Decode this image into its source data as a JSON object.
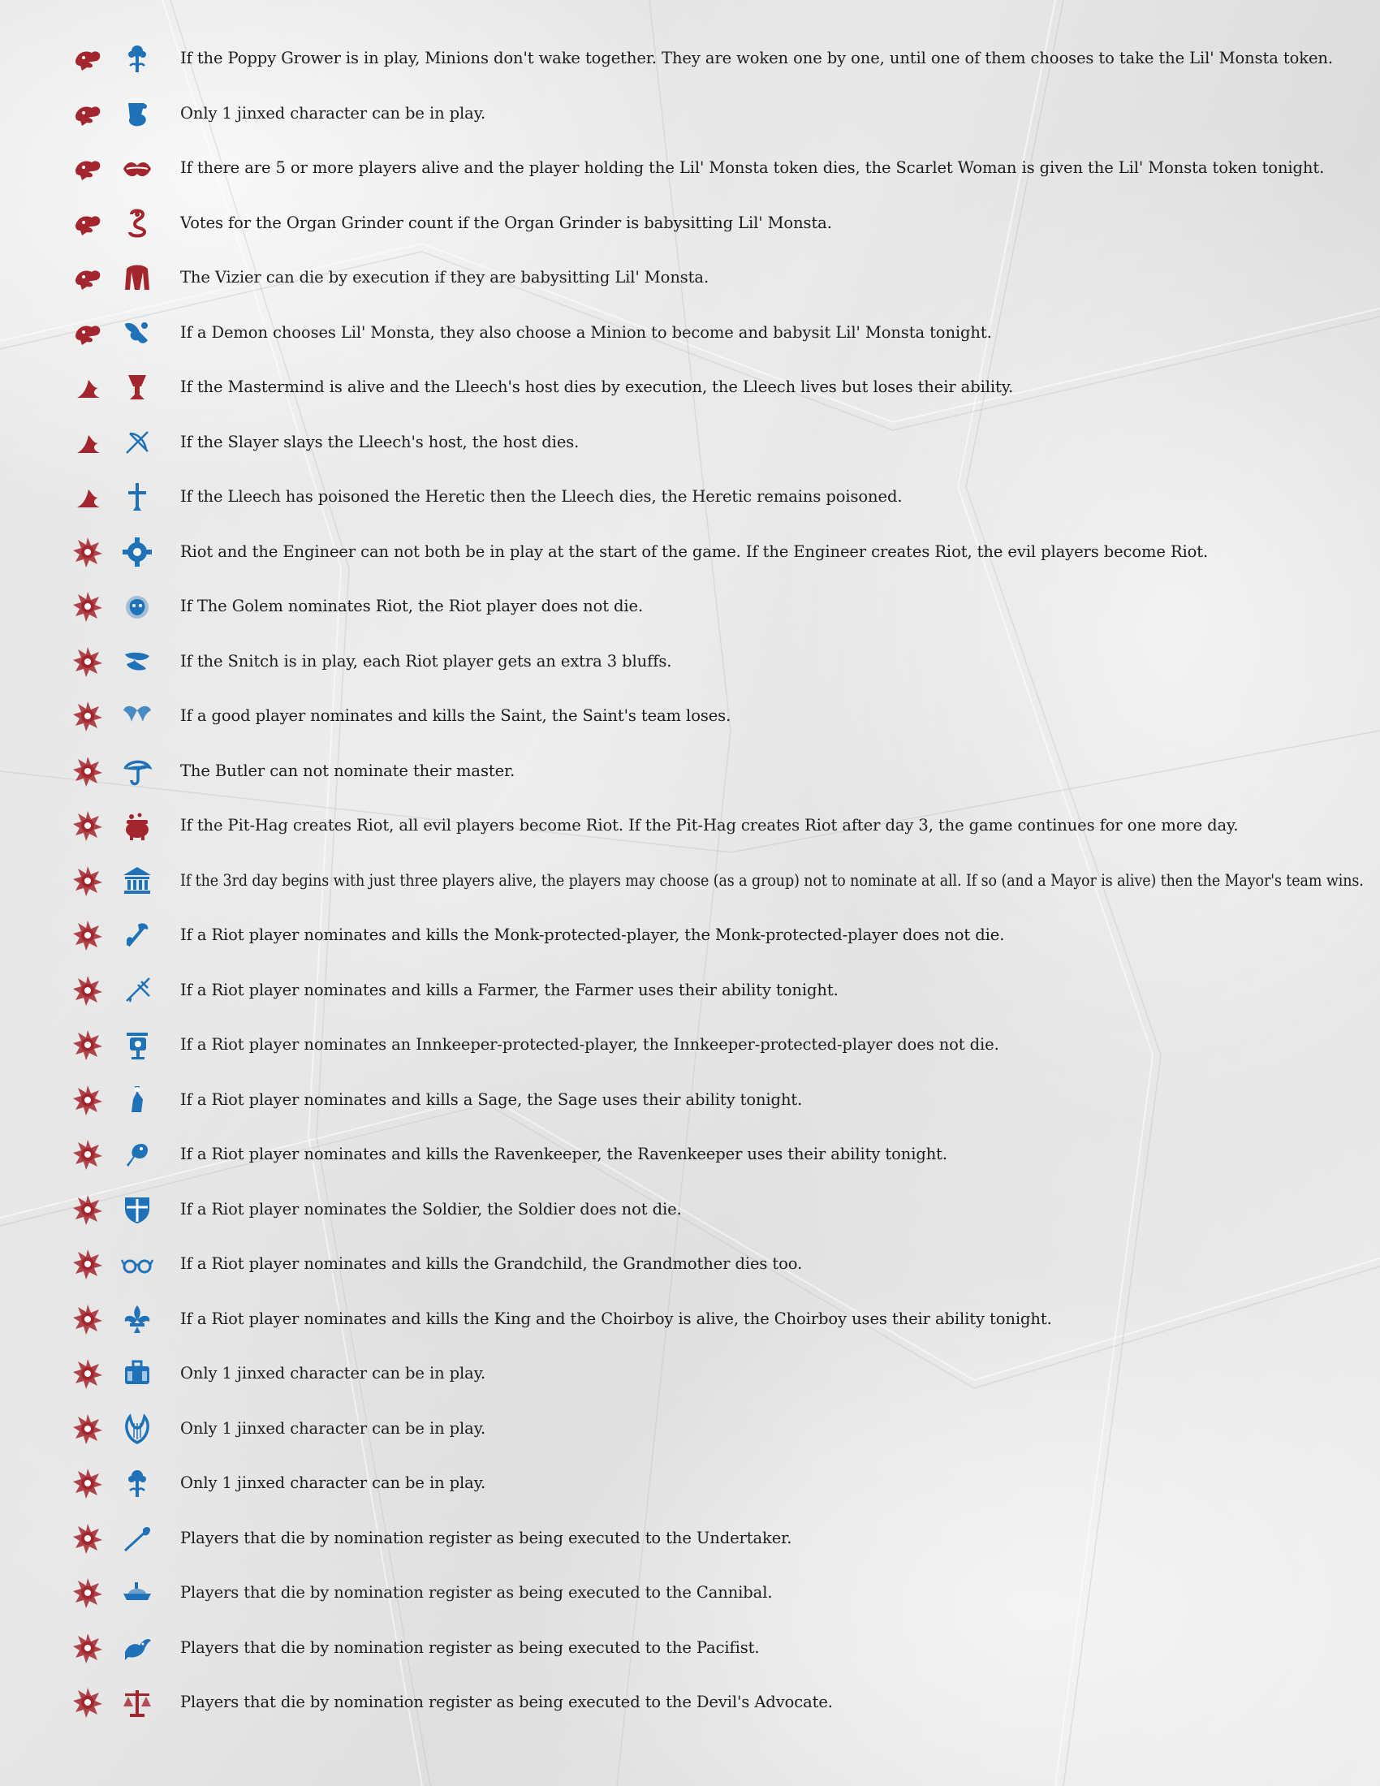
{
  "colors": {
    "evil_icon": "#a3262e",
    "good_icon": "#1f72b8",
    "text": "#1c1c1c"
  },
  "jinxes": [
    {
      "evil_icon": "lil-monsta-icon",
      "other_icon": "poppy-grower-icon",
      "other_color": "good",
      "text": "If the Poppy Grower is in play, Minions don't wake together. They are woken one by one, until one of them chooses to take the Lil' Monsta token."
    },
    {
      "evil_icon": "lil-monsta-icon",
      "other_icon": "magician-icon",
      "other_color": "good",
      "text": "Only 1 jinxed character can be in play."
    },
    {
      "evil_icon": "lil-monsta-icon",
      "other_icon": "scarlet-woman-icon",
      "other_color": "evil",
      "text": "If there are 5 or more players alive and the player holding the Lil' Monsta token dies, the Scarlet Woman is given the Lil' Monsta token tonight."
    },
    {
      "evil_icon": "lil-monsta-icon",
      "other_icon": "organ-grinder-icon",
      "other_color": "evil",
      "text": "Votes for the Organ Grinder count if the Organ Grinder is babysitting Lil' Monsta."
    },
    {
      "evil_icon": "lil-monsta-icon",
      "other_icon": "vizier-icon",
      "other_color": "evil",
      "text": "The Vizier can die by execution if they are babysitting Lil' Monsta."
    },
    {
      "evil_icon": "lil-monsta-icon",
      "other_icon": "hatter-icon",
      "other_color": "good",
      "text": "If a Demon chooses Lil' Monsta, they also choose a Minion to become and babysit Lil' Monsta tonight."
    },
    {
      "evil_icon": "lleech-icon",
      "other_icon": "mastermind-icon",
      "other_color": "evil",
      "text": "If the Mastermind is alive and the Lleech's host dies by execution, the Lleech lives but loses their ability."
    },
    {
      "evil_icon": "lleech-icon",
      "other_icon": "slayer-icon",
      "other_color": "good",
      "text": "If the Slayer slays the Lleech's host, the host dies."
    },
    {
      "evil_icon": "lleech-icon",
      "other_icon": "heretic-icon",
      "other_color": "good",
      "text": "If the Lleech has poisoned the Heretic then the Lleech dies, the Heretic remains poisoned."
    },
    {
      "evil_icon": "riot-icon",
      "other_icon": "engineer-icon",
      "other_color": "good",
      "text": "Riot and the Engineer can not both be in play at the start of the game. If the Engineer creates Riot, the evil players become Riot."
    },
    {
      "evil_icon": "riot-icon",
      "other_icon": "golem-icon",
      "other_color": "good",
      "text": "If The Golem nominates Riot, the Riot player does not die."
    },
    {
      "evil_icon": "riot-icon",
      "other_icon": "snitch-icon",
      "other_color": "good",
      "text": "If the Snitch is in play, each Riot player gets an extra 3 bluffs."
    },
    {
      "evil_icon": "riot-icon",
      "other_icon": "saint-icon",
      "other_color": "good",
      "text": "If a good player nominates and kills the Saint, the Saint's team loses."
    },
    {
      "evil_icon": "riot-icon",
      "other_icon": "butler-icon",
      "other_color": "good",
      "text": "The Butler can not nominate their master."
    },
    {
      "evil_icon": "riot-icon",
      "other_icon": "pit-hag-icon",
      "other_color": "evil",
      "text": "If the Pit-Hag creates Riot, all evil players become Riot. If the Pit-Hag creates Riot after day 3, the game continues for one more day."
    },
    {
      "evil_icon": "riot-icon",
      "other_icon": "mayor-icon",
      "other_color": "good",
      "text": "If the 3rd day begins with just three players alive, the players may choose (as a group) not to nominate at all. If so (and a Mayor is alive) then the Mayor's team wins."
    },
    {
      "evil_icon": "riot-icon",
      "other_icon": "monk-icon",
      "other_color": "good",
      "text": "If a Riot player nominates and kills the Monk-protected-player, the Monk-protected-player does not die."
    },
    {
      "evil_icon": "riot-icon",
      "other_icon": "farmer-icon",
      "other_color": "good",
      "text": "If a Riot player nominates and kills a Farmer, the Farmer uses their ability tonight."
    },
    {
      "evil_icon": "riot-icon",
      "other_icon": "innkeeper-icon",
      "other_color": "good",
      "text": "If a Riot player nominates an Innkeeper-protected-player, the Innkeeper-protected-player does not die."
    },
    {
      "evil_icon": "riot-icon",
      "other_icon": "sage-icon",
      "other_color": "good",
      "text": "If a Riot player nominates and kills a Sage, the Sage uses their ability tonight."
    },
    {
      "evil_icon": "riot-icon",
      "other_icon": "ravenkeeper-icon",
      "other_color": "good",
      "text": "If a Riot player nominates and kills the Ravenkeeper, the Ravenkeeper uses their ability tonight."
    },
    {
      "evil_icon": "riot-icon",
      "other_icon": "soldier-icon",
      "other_color": "good",
      "text": "If a Riot player nominates the Soldier, the Soldier does not die."
    },
    {
      "evil_icon": "riot-icon",
      "other_icon": "grandmother-icon",
      "other_color": "good",
      "text": "If a Riot player nominates and kills the Grandchild, the Grandmother dies too."
    },
    {
      "evil_icon": "riot-icon",
      "other_icon": "choirboy-icon",
      "other_color": "good",
      "text": "If a Riot player nominates and kills the King and the Choirboy is alive, the Choirboy uses their ability tonight."
    },
    {
      "evil_icon": "riot-icon",
      "other_icon": "banshee-icon",
      "other_color": "good",
      "text": "Only 1 jinxed character can be in play."
    },
    {
      "evil_icon": "riot-icon",
      "other_icon": "minstrel-icon",
      "other_color": "good",
      "text": "Only 1 jinxed character can be in play."
    },
    {
      "evil_icon": "riot-icon",
      "other_icon": "poppy-grower-icon",
      "other_color": "good",
      "text": "Only 1 jinxed character can be in play."
    },
    {
      "evil_icon": "riot-icon",
      "other_icon": "undertaker-icon",
      "other_color": "good",
      "text": "Players that die by nomination register as being executed to the Undertaker."
    },
    {
      "evil_icon": "riot-icon",
      "other_icon": "cannibal-icon",
      "other_color": "good",
      "text": "Players that die by nomination register as being executed to the Cannibal."
    },
    {
      "evil_icon": "riot-icon",
      "other_icon": "pacifist-icon",
      "other_color": "good",
      "text": "Players that die by nomination register as being executed to the Pacifist."
    },
    {
      "evil_icon": "riot-icon",
      "other_icon": "devils-advocate-icon",
      "other_color": "evil",
      "text": "Players that die by nomination register as being executed to the Devil's Advocate."
    }
  ]
}
